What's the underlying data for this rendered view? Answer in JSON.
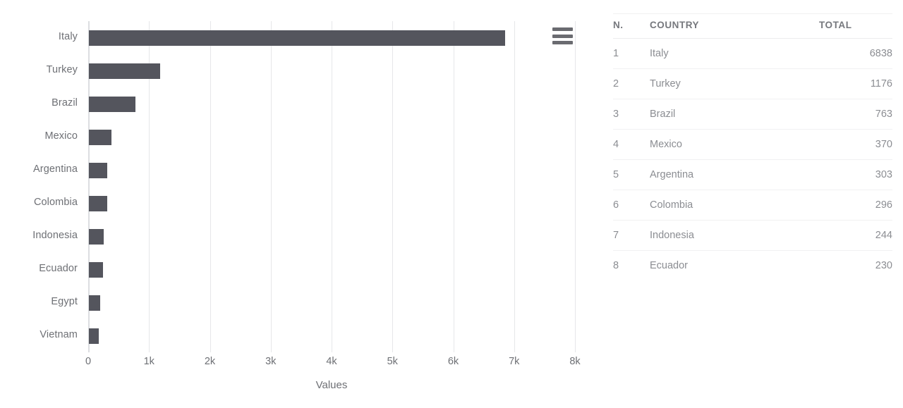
{
  "chart_data": {
    "type": "bar",
    "orientation": "horizontal",
    "title": "",
    "xlabel": "Values",
    "ylabel": "",
    "xlim": [
      0,
      8000
    ],
    "grid": true,
    "legend": false,
    "bar_color": "#54555d",
    "x_tick_labels": [
      "0",
      "1k",
      "2k",
      "3k",
      "4k",
      "5k",
      "6k",
      "7k",
      "8k"
    ],
    "x_tick_values": [
      0,
      1000,
      2000,
      3000,
      4000,
      5000,
      6000,
      7000,
      8000
    ],
    "categories": [
      "Italy",
      "Turkey",
      "Brazil",
      "Mexico",
      "Argentina",
      "Colombia",
      "Indonesia",
      "Ecuador",
      "Egypt",
      "Vietnam"
    ],
    "values": [
      6838,
      1176,
      763,
      370,
      303,
      296,
      244,
      230,
      185,
      165
    ]
  },
  "chart": {
    "menu_icon": "hamburger-menu-icon"
  },
  "table": {
    "columns": [
      "N.",
      "COUNTRY",
      "TOTAL"
    ],
    "rows": [
      {
        "n": "1",
        "country": "Italy",
        "total": "6838"
      },
      {
        "n": "2",
        "country": "Turkey",
        "total": "1176"
      },
      {
        "n": "3",
        "country": "Brazil",
        "total": "763"
      },
      {
        "n": "4",
        "country": "Mexico",
        "total": "370"
      },
      {
        "n": "5",
        "country": "Argentina",
        "total": "303"
      },
      {
        "n": "6",
        "country": "Colombia",
        "total": "296"
      },
      {
        "n": "7",
        "country": "Indonesia",
        "total": "244"
      },
      {
        "n": "8",
        "country": "Ecuador",
        "total": "230"
      }
    ]
  },
  "colors": {
    "bar": "#54555d",
    "grid": "#e6e7e9",
    "axis_text": "#6e7075",
    "table_text": "#8b8d92",
    "table_header_text": "#76787d",
    "table_border": "#f1f1f2"
  }
}
